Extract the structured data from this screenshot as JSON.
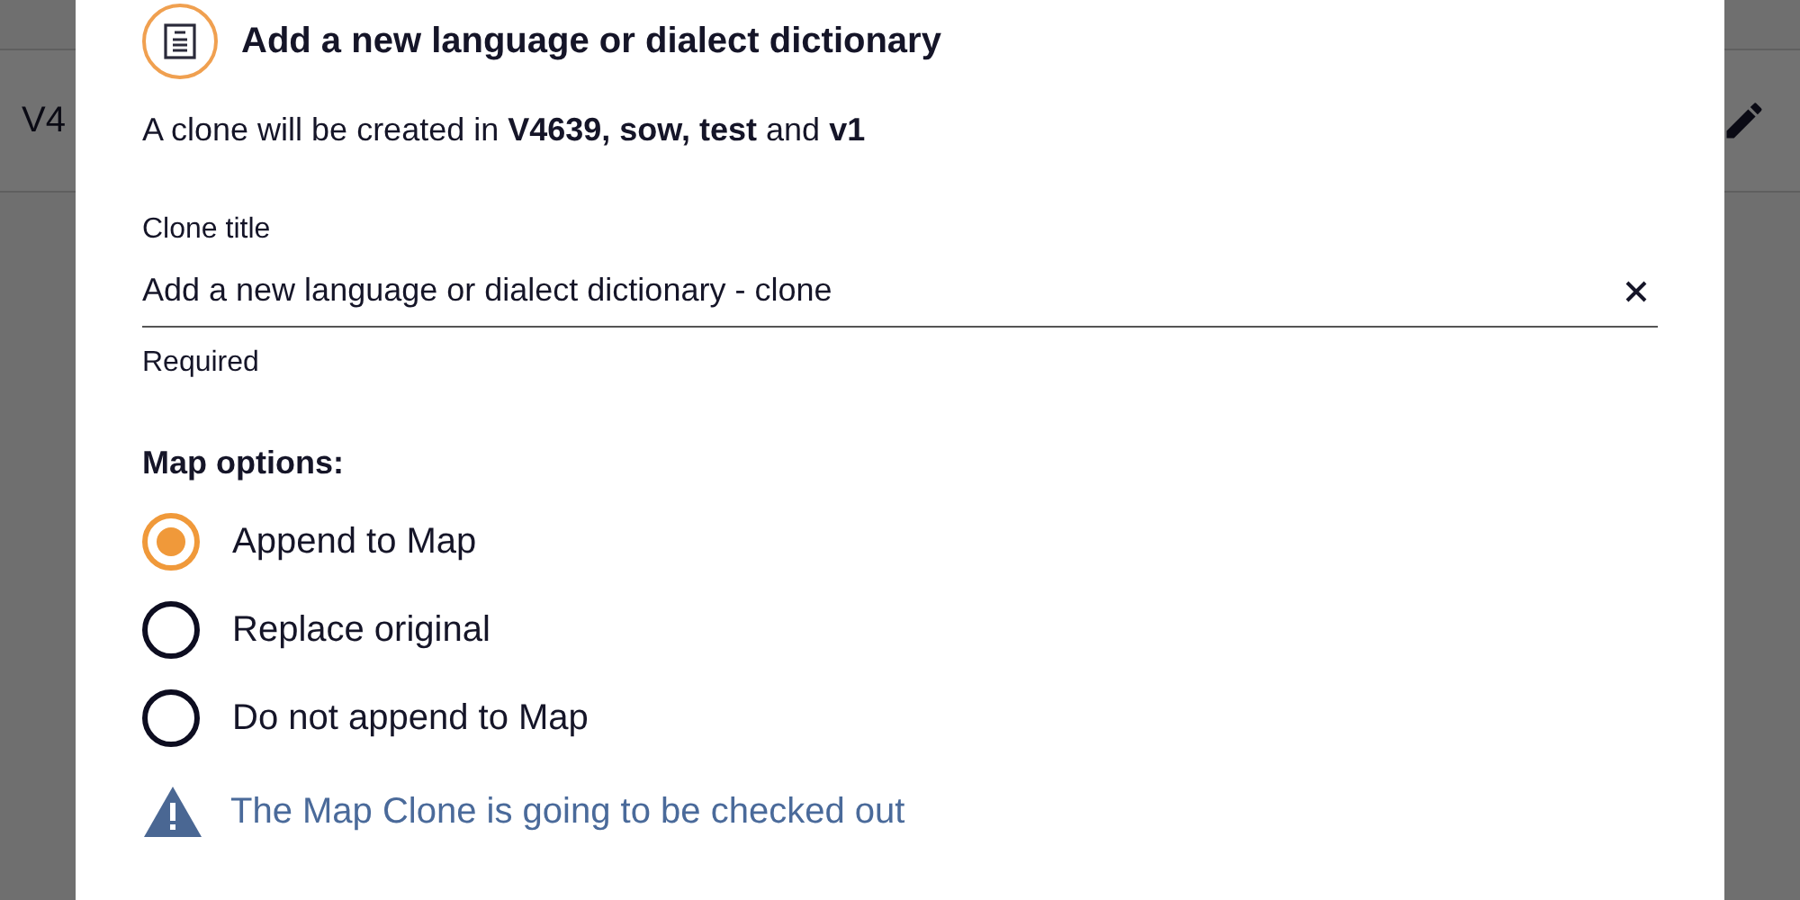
{
  "background": {
    "header_text": "V4"
  },
  "dialog": {
    "title": "Add a new language or dialect dictionary",
    "subtitle": "A clone will be created in **V4639, sow, test** and **v1**",
    "field": {
      "label": "Clone title",
      "value": "Add a new language or dialect dictionary - clone",
      "helper": "Required"
    },
    "options_label": "Map options:",
    "options": [
      {
        "label": "Append to Map",
        "selected": true
      },
      {
        "label": "Replace original",
        "selected": false
      },
      {
        "label": "Do not append to Map",
        "selected": false
      }
    ],
    "warning": "The Map Clone is going to be checked out"
  }
}
